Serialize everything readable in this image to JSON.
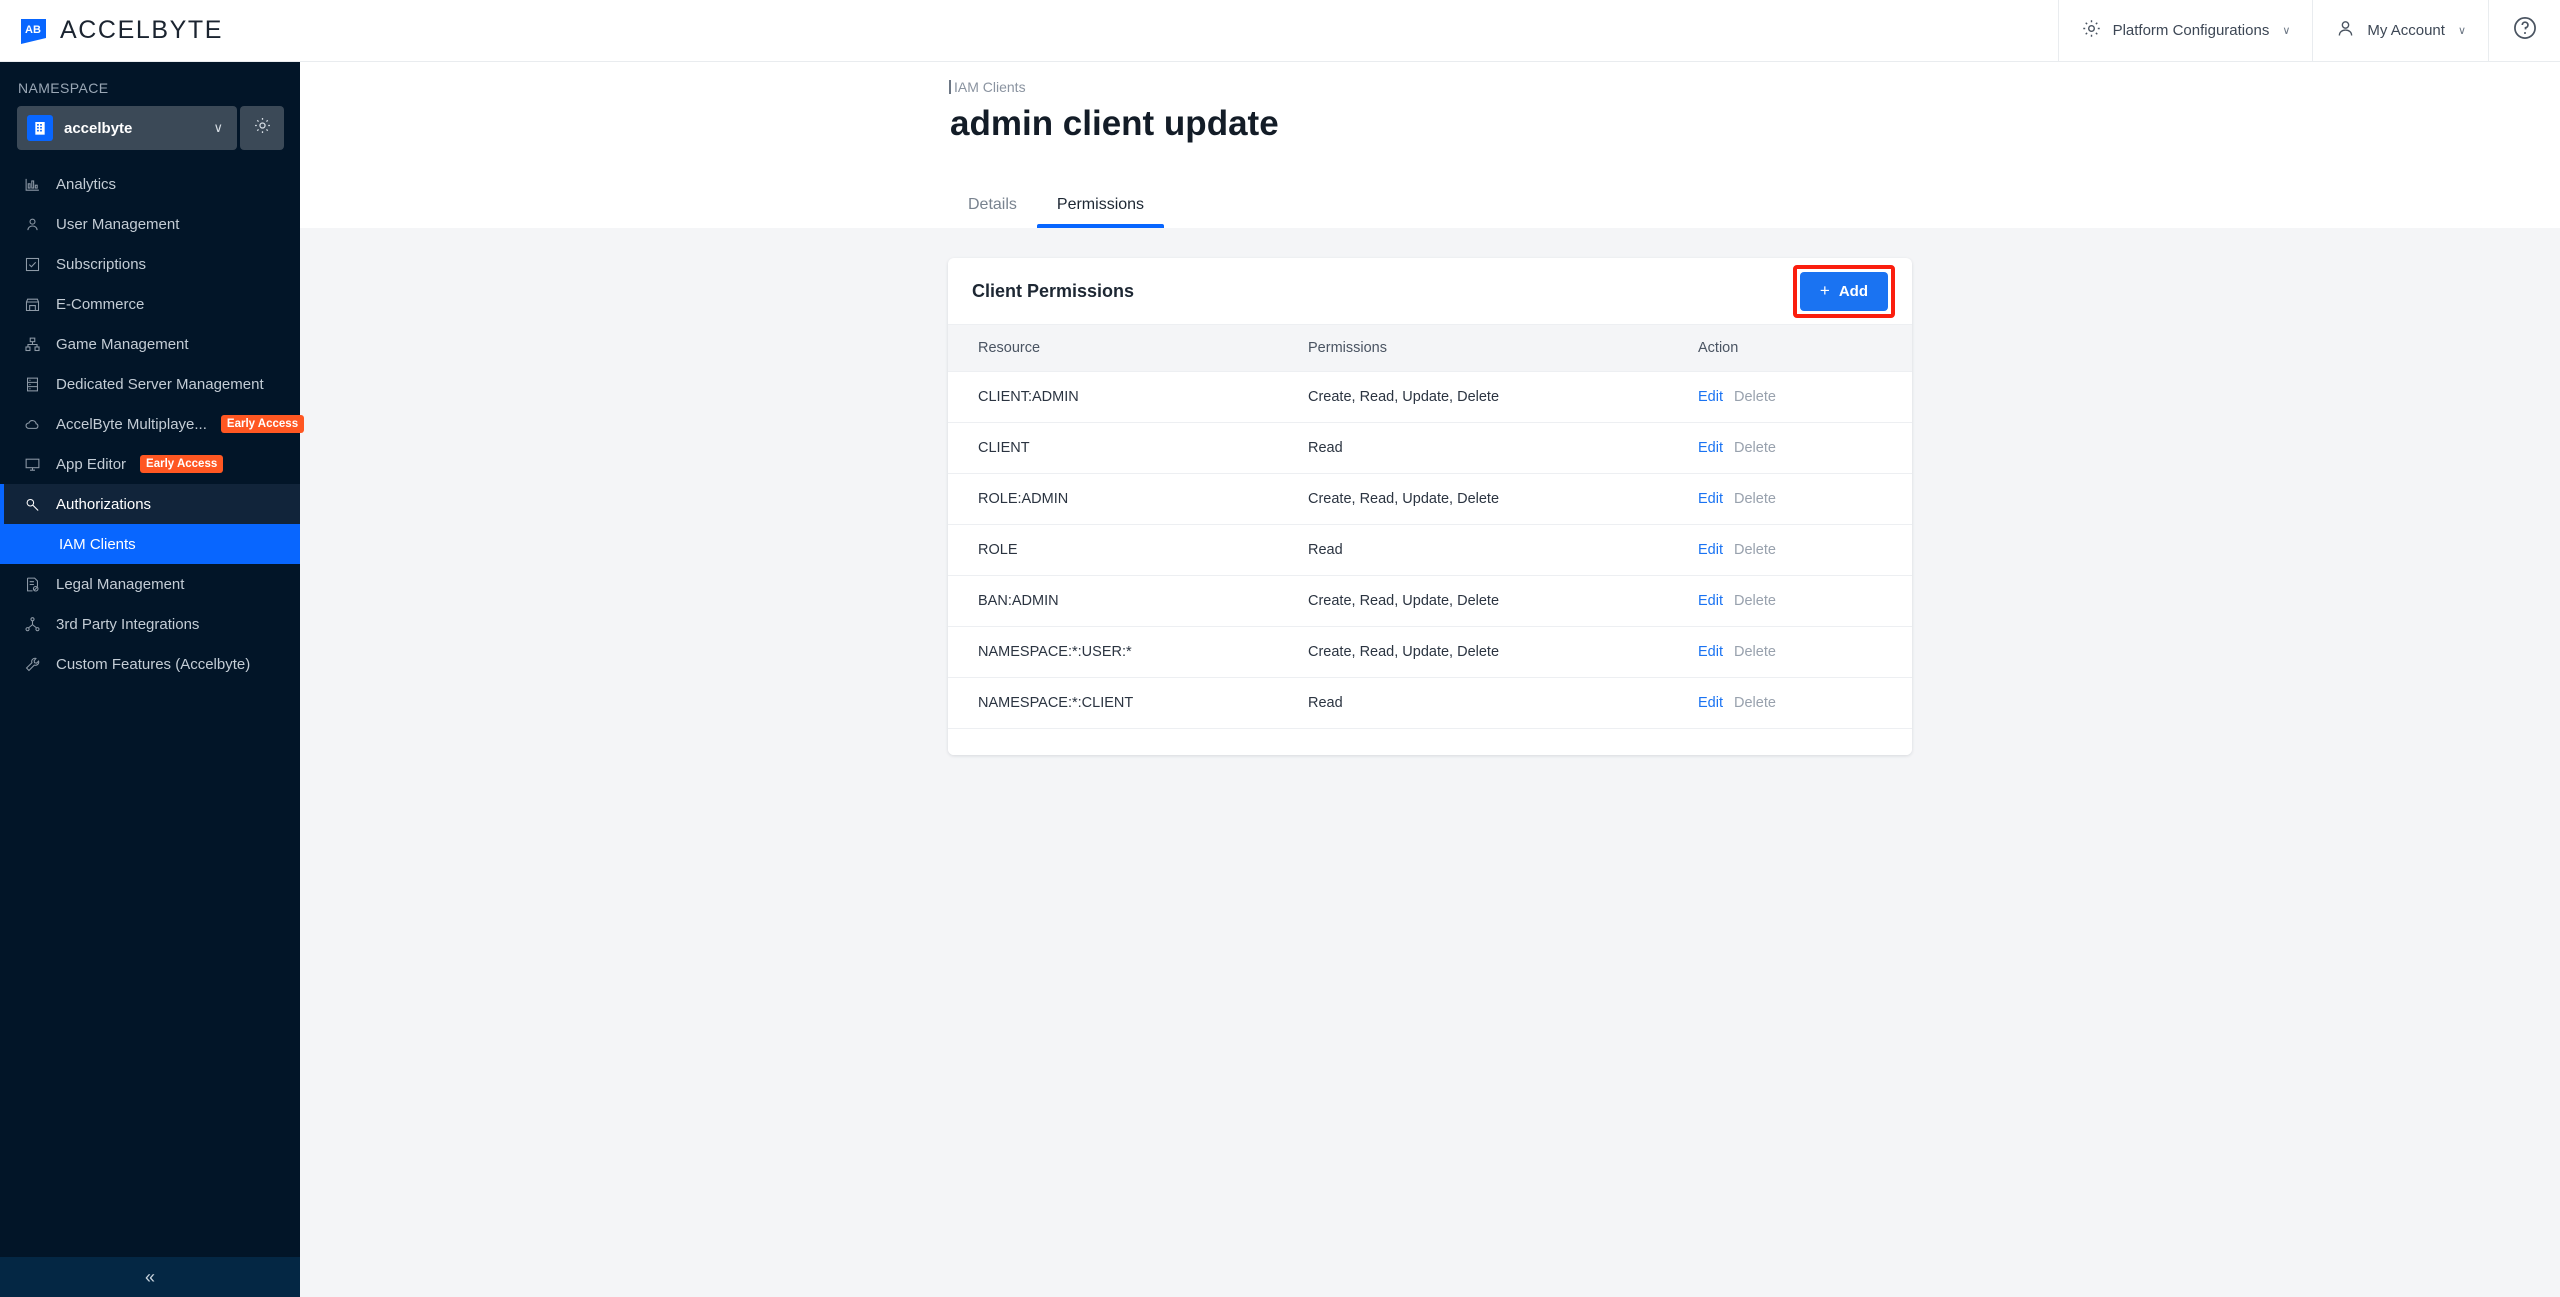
{
  "topbar": {
    "brand_name": "ACCELBYTE",
    "logo_icon": "accelbyte-logo-icon",
    "platform_config_label": "Platform Configurations",
    "platform_config_icon": "gear-icon",
    "account_label": "My Account",
    "account_icon": "user-icon",
    "chevron": "∨",
    "help_icon": "help-circle-icon"
  },
  "sidebar": {
    "namespace_label": "NAMESPACE",
    "namespace_value": "accelbyte",
    "namespace_icon": "building-icon",
    "namespace_chevron": "∨",
    "settings_icon": "gear-icon",
    "collapse_icon": "«",
    "items": [
      {
        "label": "Analytics",
        "icon": "bar-chart-icon",
        "badge": "",
        "state": "normal"
      },
      {
        "label": "User Management",
        "icon": "person-icon",
        "badge": "",
        "state": "normal"
      },
      {
        "label": "Subscriptions",
        "icon": "checkbox-icon",
        "badge": "",
        "state": "normal"
      },
      {
        "label": "E-Commerce",
        "icon": "storefront-icon",
        "badge": "",
        "state": "normal"
      },
      {
        "label": "Game Management",
        "icon": "sitemap-icon",
        "badge": "",
        "state": "normal"
      },
      {
        "label": "Dedicated Server Management",
        "icon": "server-icon",
        "badge": "",
        "state": "normal"
      },
      {
        "label": "AccelByte Multiplaye...",
        "icon": "cloud-icon",
        "badge": "Early Access",
        "state": "normal"
      },
      {
        "label": "App Editor",
        "icon": "monitor-icon",
        "badge": "Early Access",
        "state": "normal"
      },
      {
        "label": "Authorizations",
        "icon": "key-search-icon",
        "badge": "",
        "state": "active-parent"
      },
      {
        "label": "Legal Management",
        "icon": "legal-doc-icon",
        "badge": "",
        "state": "normal"
      },
      {
        "label": "3rd Party Integrations",
        "icon": "integrations-icon",
        "badge": "",
        "state": "normal"
      },
      {
        "label": "Custom Features (Accelbyte)",
        "icon": "wrench-icon",
        "badge": "",
        "state": "normal"
      }
    ],
    "sub_item": {
      "label": "IAM Clients",
      "state": "active"
    }
  },
  "page": {
    "breadcrumb": "IAM Clients",
    "title": "admin client update",
    "tabs": [
      {
        "label": "Details",
        "active": false
      },
      {
        "label": "Permissions",
        "active": true
      }
    ]
  },
  "card": {
    "title": "Client Permissions",
    "add_button": {
      "label": "Add",
      "plus": "+",
      "highlighted": true
    },
    "columns": [
      "Resource",
      "Permissions",
      "Action"
    ],
    "actions": {
      "edit": "Edit",
      "delete": "Delete"
    },
    "rows": [
      {
        "resource": "CLIENT:ADMIN",
        "permissions": "Create, Read, Update, Delete"
      },
      {
        "resource": "CLIENT",
        "permissions": "Read"
      },
      {
        "resource": "ROLE:ADMIN",
        "permissions": "Create, Read, Update, Delete"
      },
      {
        "resource": "ROLE",
        "permissions": "Read"
      },
      {
        "resource": "BAN:ADMIN",
        "permissions": "Create, Read, Update, Delete"
      },
      {
        "resource": "NAMESPACE:*:USER:*",
        "permissions": "Create, Read, Update, Delete"
      },
      {
        "resource": "NAMESPACE:*:CLIENT",
        "permissions": "Read"
      }
    ]
  },
  "colors": {
    "accent_blue": "#0866ff",
    "link_blue": "#1a73f2",
    "sidebar_bg": "#021528",
    "badge_orange": "#ff5722",
    "highlight_red": "#fa1e0e",
    "content_bg": "#f4f5f7"
  }
}
